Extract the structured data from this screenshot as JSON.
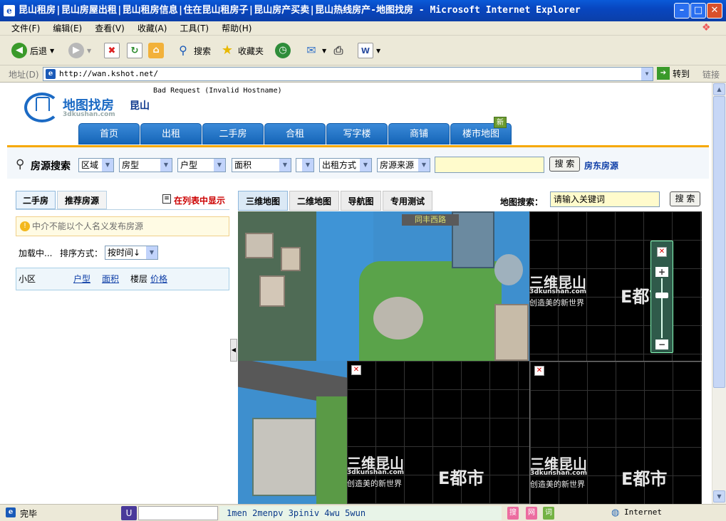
{
  "window": {
    "title": "昆山租房|昆山房屋出租|昆山租房信息|住在昆山租房子|昆山房产买卖|昆山热线房产-地图找房 - Microsoft Internet Explorer"
  },
  "menu": {
    "items": [
      "文件(F)",
      "编辑(E)",
      "查看(V)",
      "收藏(A)",
      "工具(T)",
      "帮助(H)"
    ]
  },
  "toolbar": {
    "back_label": "后退",
    "search_label": "搜索",
    "favorites_label": "收藏夹"
  },
  "address": {
    "label": "地址(D)",
    "url": "http://wan.kshot.net/",
    "go_label": "转到",
    "links_label": "链接"
  },
  "header": {
    "error_text": "Bad Request (Invalid Hostname)",
    "logo_text": "地图找房",
    "logo_sub": "3dkushan.com",
    "city": "昆山",
    "nav": [
      "首页",
      "出租",
      "二手房",
      "合租",
      "写字楼",
      "商铺",
      "楼市地图"
    ],
    "new_badge": "新"
  },
  "search": {
    "title": "房源搜索",
    "filters": [
      "区域",
      "房型",
      "户型",
      "面积",
      "",
      "出租方式",
      "房源来源"
    ],
    "input_value": "",
    "button_label": "搜 索",
    "landlord_link": "房东房源"
  },
  "left_panel": {
    "tabs": [
      "二手房",
      "推荐房源"
    ],
    "list_toggle": "在列表中显示",
    "warning": "中介不能以个人名义发布房源",
    "loading": "加载中...",
    "sort_label": "排序方式：",
    "sort_value": "按时间↓",
    "columns": [
      "小区",
      "户型",
      "面积",
      "楼层",
      "价格"
    ]
  },
  "map": {
    "tabs": [
      "三维地图",
      "二维地图",
      "导航图",
      "专用测试"
    ],
    "search_label": "地图搜索：",
    "search_placeholder": "请输入关键词",
    "search_button": "搜 索",
    "street_sign": "同丰西路",
    "brand_main": "三维昆山",
    "brand_url": "3dkunshan.com",
    "brand_slogan": "创造美的新世界",
    "brand_e": "E都市"
  },
  "status": {
    "text": "完毕",
    "ime_text": "1men 2menpv 3piniv 4wu 5wun",
    "zone": "Internet"
  },
  "colors": {
    "nav_blue": "#1565b8",
    "accent_orange": "#f6a800",
    "list_red": "#cc0000",
    "link_blue": "#1040a8"
  }
}
